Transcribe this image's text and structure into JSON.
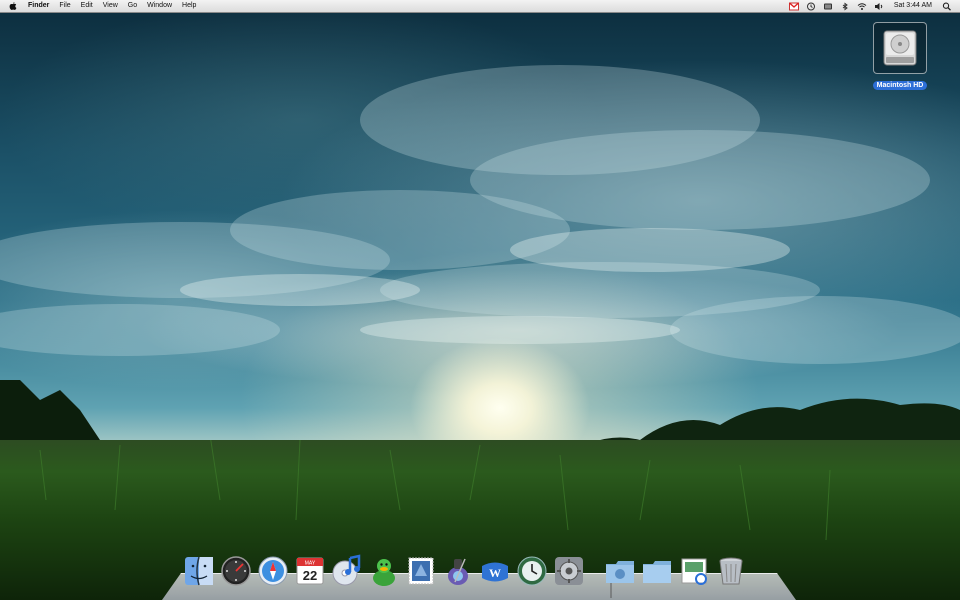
{
  "menubar": {
    "app_name": "Finder",
    "menus": [
      "File",
      "Edit",
      "View",
      "Go",
      "Window",
      "Help"
    ],
    "clock": "Sat 3:44 AM"
  },
  "desktop": {
    "hd_label": "Macintosh HD"
  },
  "dock": {
    "items": [
      "finder",
      "dashboard",
      "safari",
      "ical",
      "itunes",
      "adium",
      "mail",
      "iphoto",
      "word",
      "time-machine",
      "system-preferences",
      "applications-folder",
      "documents-folder",
      "preview",
      "trash"
    ],
    "calendar_month": "MAY",
    "calendar_day": "22"
  },
  "colors": {
    "menubar": "#dcdcdc",
    "label_highlight": "#2d6fd8",
    "sky_top": "#0c2c3c",
    "grass": "#1d4412"
  }
}
